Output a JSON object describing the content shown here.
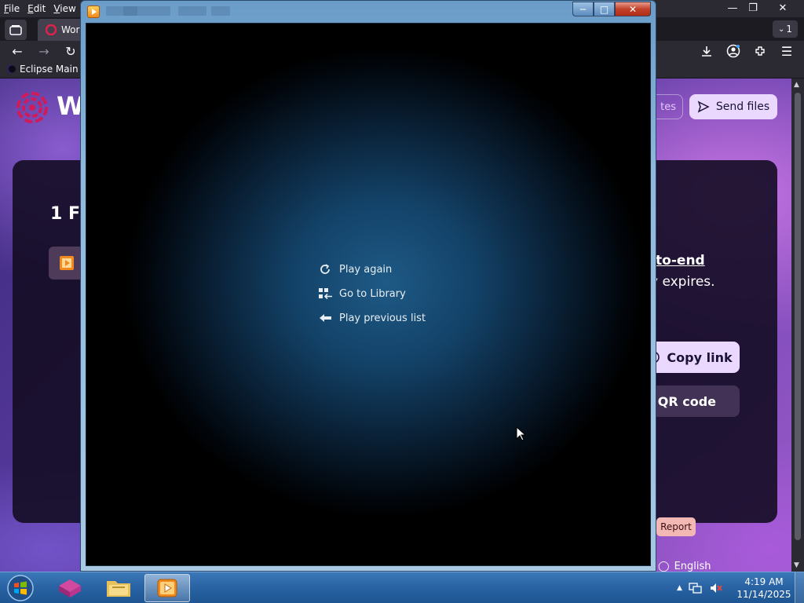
{
  "browser": {
    "menubar": [
      "File",
      "Edit",
      "View"
    ],
    "tab_title": "Wor",
    "tab_count": "1",
    "bookmark": "Eclipse Main S"
  },
  "webpage": {
    "logo_letters": "W",
    "updates_label": "tes",
    "send_files_label": "Send files",
    "files_heading": "1 Fi",
    "e2e_text": "-to-end",
    "expires_text": "y expires.",
    "copy_link_label": "Copy link",
    "qr_label": "w QR code",
    "report_label": "Report",
    "language_label": "English"
  },
  "player": {
    "menu_items": [
      {
        "label": "Play again",
        "icon": "replay-icon"
      },
      {
        "label": "Go to Library",
        "icon": "library-icon"
      },
      {
        "label": "Play previous list",
        "icon": "back-arrow-icon"
      }
    ]
  },
  "taskbar": {
    "time": "4:19 AM",
    "date": "11/14/2025",
    "apps": [
      "start-orb",
      "app-cube-icon",
      "file-explorer-icon",
      "media-player-icon"
    ]
  },
  "colors": {
    "taskbar": "#2a64a4",
    "send_button": "#ead8ff",
    "report_button": "#f4b8b4",
    "player_stage": "#134268"
  }
}
